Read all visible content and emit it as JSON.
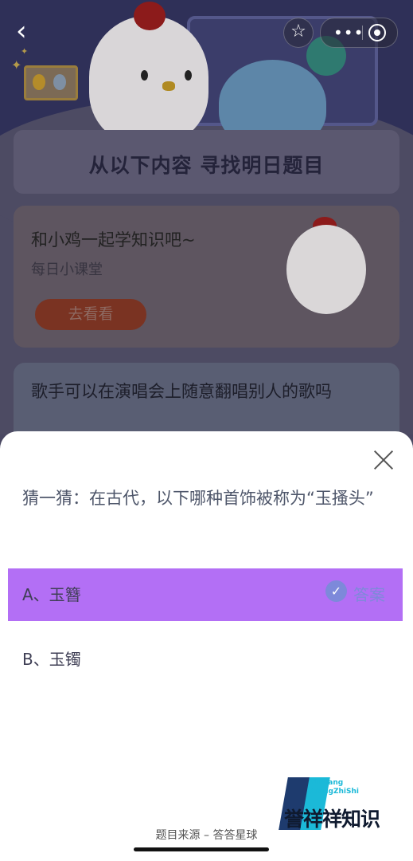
{
  "nav": {
    "back_icon": "chevron-left-icon",
    "star_icon": "star-outline-icon",
    "more_icon": "more-dots-icon",
    "close_app_icon": "target-icon",
    "more_glyph": "•••",
    "star_glyph": "☆",
    "back_glyph": "‹"
  },
  "find_section": {
    "title": "从以下内容  寻找明日题目"
  },
  "lesson_card": {
    "title": "和小鸡一起学知识吧~",
    "subtitle": "每日小课堂",
    "button_label": "去看看"
  },
  "peek_card": {
    "question": "歌手可以在演唱会上随意翻唱别人的歌吗"
  },
  "quiz_sheet": {
    "question": "猜一猜：在古代，以下哪种首饰被称为“玉搔头”",
    "options": [
      {
        "label": "A、玉簪",
        "is_answer": true
      },
      {
        "label": "B、玉镯",
        "is_answer": false
      }
    ],
    "answer_badge": "答案",
    "source": "题目来源 – 答答星球"
  },
  "watermark": {
    "en_line1": "YuXiang",
    "en_line2": "XiangZhiShi",
    "cn": "誉祥祥知识"
  },
  "colors": {
    "highlight": "#b36ff5",
    "answer_accent": "#7e89d9",
    "question_text": "#4e566a"
  }
}
